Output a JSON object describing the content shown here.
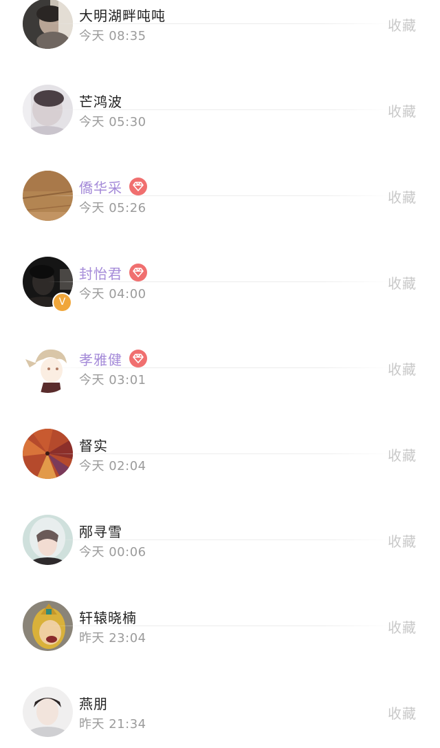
{
  "list": {
    "items": [
      {
        "name": "大明湖畔吨吨",
        "time": "今天 08:35",
        "action": "收藏",
        "vip": false,
        "v_badge": false,
        "avatar_icon": "photo-avatar-icon"
      },
      {
        "name": "芒鸿波",
        "time": "今天 05:30",
        "action": "收藏",
        "vip": false,
        "v_badge": false,
        "avatar_icon": "photo-avatar-icon"
      },
      {
        "name": "僑华采",
        "time": "今天 05:26",
        "action": "收藏",
        "vip": true,
        "v_badge": false,
        "avatar_icon": "photo-avatar-icon"
      },
      {
        "name": "封怡君",
        "time": "今天 04:00",
        "action": "收藏",
        "vip": true,
        "v_badge": true,
        "v_badge_text": "V",
        "avatar_icon": "photo-avatar-icon"
      },
      {
        "name": "孝雅健",
        "time": "今天 03:01",
        "action": "收藏",
        "vip": true,
        "v_badge": false,
        "avatar_icon": "anime-avatar-icon"
      },
      {
        "name": "督实",
        "time": "今天 02:04",
        "action": "收藏",
        "vip": false,
        "v_badge": false,
        "avatar_icon": "photo-avatar-icon"
      },
      {
        "name": "邴寻雪",
        "time": "今天 00:06",
        "action": "收藏",
        "vip": false,
        "v_badge": false,
        "avatar_icon": "photo-avatar-icon"
      },
      {
        "name": "轩辕晓楠",
        "time": "昨天 23:04",
        "action": "收藏",
        "vip": false,
        "v_badge": false,
        "avatar_icon": "cartoon-avatar-icon"
      },
      {
        "name": "燕朋",
        "time": "昨天 21:34",
        "action": "收藏",
        "vip": false,
        "v_badge": false,
        "avatar_icon": "photo-avatar-icon"
      }
    ]
  },
  "colors": {
    "name_default": "#222222",
    "name_vip": "#a48ad8",
    "time": "#9b9b9b",
    "action": "#c8c8c8",
    "vip_badge": "#f06f6f",
    "v_badge": "#f0a63a"
  },
  "icons": {
    "vip_badge": "diamond-icon"
  }
}
